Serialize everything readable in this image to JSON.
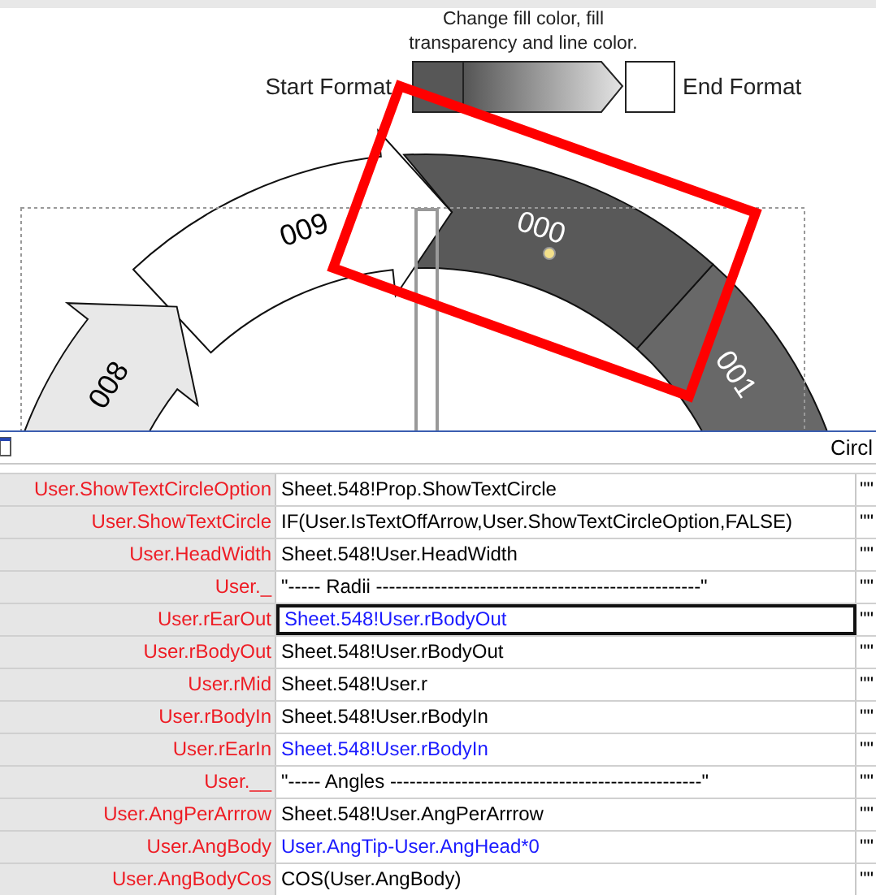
{
  "drawing": {
    "caption_lines": [
      "Change fill color, fill",
      "transparency and line color."
    ],
    "start_label": "Start Format",
    "end_label": "End Format",
    "segments": [
      {
        "label": "001",
        "color": "#686868",
        "kind": "band"
      },
      {
        "label": "000",
        "color": "#595959",
        "kind": "band"
      },
      {
        "label": "009",
        "color": "#ffffff",
        "kind": "arrow"
      },
      {
        "label": "008",
        "color": "#e8e8e8",
        "kind": "arrow"
      }
    ]
  },
  "shapesheet": {
    "title": "Circl",
    "rows": [
      {
        "name": "User.ShowTextCircleOption",
        "formula": "Sheet.548!Prop.ShowTextCircle",
        "local": false,
        "selected": false,
        "column_3": "\"\""
      },
      {
        "name": "User.ShowTextCircle",
        "formula": "IF(User.IsTextOffArrow,User.ShowTextCircleOption,FALSE)",
        "local": false,
        "selected": false,
        "column_3": "\"\""
      },
      {
        "name": "User.HeadWidth",
        "formula": "Sheet.548!User.HeadWidth",
        "local": false,
        "selected": false,
        "column_3": "\"\""
      },
      {
        "name": "User._",
        "formula": "\"----- Radii --------------------------------------------------\"",
        "local": false,
        "selected": false,
        "column_3": "\"\""
      },
      {
        "name": "User.rEarOut",
        "formula": "Sheet.548!User.rBodyOut",
        "local": true,
        "selected": true,
        "column_3": "\"\""
      },
      {
        "name": "User.rBodyOut",
        "formula": "Sheet.548!User.rBodyOut",
        "local": false,
        "selected": false,
        "column_3": "\"\""
      },
      {
        "name": "User.rMid",
        "formula": "Sheet.548!User.r",
        "local": false,
        "selected": false,
        "column_3": "\"\""
      },
      {
        "name": "User.rBodyIn",
        "formula": "Sheet.548!User.rBodyIn",
        "local": false,
        "selected": false,
        "column_3": "\"\""
      },
      {
        "name": "User.rEarIn",
        "formula": "Sheet.548!User.rBodyIn",
        "local": true,
        "selected": false,
        "column_3": "\"\""
      },
      {
        "name": "User.__",
        "formula": "\"----- Angles ------------------------------------------------\"",
        "local": false,
        "selected": false,
        "column_3": "\"\""
      },
      {
        "name": "User.AngPerArrrow",
        "formula": "Sheet.548!User.AngPerArrrow",
        "local": false,
        "selected": false,
        "column_3": "\"\""
      },
      {
        "name": "User.AngBody",
        "formula": "User.AngTip-User.AngHead*0",
        "local": true,
        "selected": false,
        "column_3": "\"\""
      },
      {
        "name": "User.AngBodyCos",
        "formula": "COS(User.AngBody)",
        "local": false,
        "selected": false,
        "column_3": "\"\""
      }
    ]
  }
}
